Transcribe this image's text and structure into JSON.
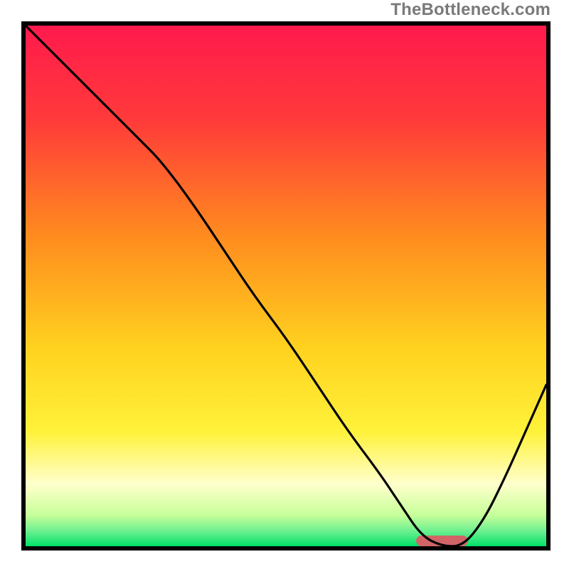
{
  "watermark": "TheBottleneck.com",
  "colors": {
    "frame": "#000000",
    "curve": "#000000",
    "marker": "#d16467",
    "gradient_stops": [
      {
        "pct": 0,
        "color": "#ff1a4d"
      },
      {
        "pct": 18,
        "color": "#ff3a3a"
      },
      {
        "pct": 40,
        "color": "#ff8a1f"
      },
      {
        "pct": 62,
        "color": "#ffd21f"
      },
      {
        "pct": 78,
        "color": "#fff23a"
      },
      {
        "pct": 88,
        "color": "#ffffcc"
      },
      {
        "pct": 94,
        "color": "#c8ff9a"
      },
      {
        "pct": 97,
        "color": "#70f090"
      },
      {
        "pct": 100,
        "color": "#00e26a"
      }
    ]
  },
  "chart_data": {
    "type": "line",
    "title": "",
    "xlabel": "",
    "ylabel": "",
    "xlim": [
      0,
      100
    ],
    "ylim": [
      0,
      100
    ],
    "x": [
      0,
      6,
      12,
      18,
      22,
      26,
      32,
      38,
      44,
      50,
      56,
      62,
      68,
      72,
      76,
      80,
      84,
      88,
      92,
      96,
      100
    ],
    "values": [
      100,
      94,
      88,
      82,
      78,
      74,
      66,
      57,
      48,
      40,
      31,
      22,
      14,
      8,
      2,
      0,
      0,
      5,
      13,
      22,
      31
    ],
    "marker": {
      "x_center": 80,
      "width": 10,
      "y": 0,
      "height": 2
    }
  }
}
